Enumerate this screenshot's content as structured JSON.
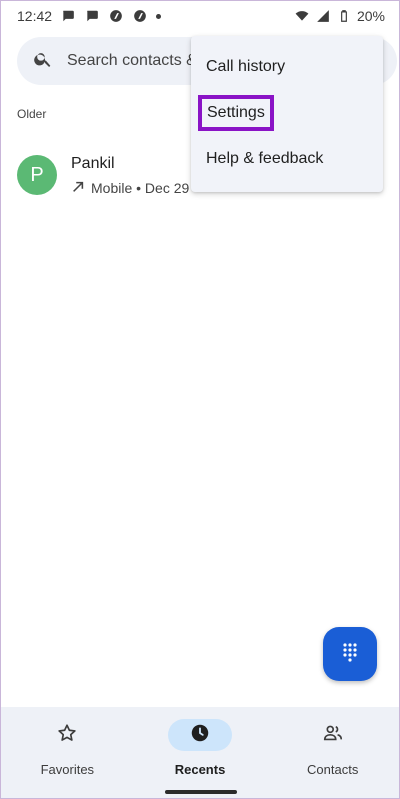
{
  "status_bar": {
    "time": "12:42",
    "battery": "20%",
    "notification_icons": [
      "chat-bubble-icon",
      "chat-bubble-icon",
      "app-icon",
      "app-icon",
      "dot-icon"
    ],
    "system_icons": [
      "wifi-icon",
      "cell-signal-icon",
      "battery-icon"
    ]
  },
  "search": {
    "placeholder": "Search contacts & places"
  },
  "recents": {
    "section_label": "Older",
    "calls": [
      {
        "avatar_letter": "P",
        "avatar_color": "#5bb974",
        "name": "Pankil",
        "call_type_icon": "outgoing-call-arrow-icon",
        "detail": "Mobile • Dec 29"
      }
    ]
  },
  "overflow_menu": {
    "items": [
      {
        "label": "Call history"
      },
      {
        "label": "Settings",
        "highlighted": true
      },
      {
        "label": "Help & feedback"
      }
    ],
    "highlight_color": "#8a13c6"
  },
  "fab": {
    "icon": "dialpad-icon",
    "color": "#1a5ed6"
  },
  "bottom_nav": {
    "items": [
      {
        "label": "Favorites",
        "icon": "star-outline-icon",
        "active": false
      },
      {
        "label": "Recents",
        "icon": "clock-icon",
        "active": true
      },
      {
        "label": "Contacts",
        "icon": "people-icon",
        "active": false
      }
    ],
    "active_pill_color": "#cde5fb"
  }
}
